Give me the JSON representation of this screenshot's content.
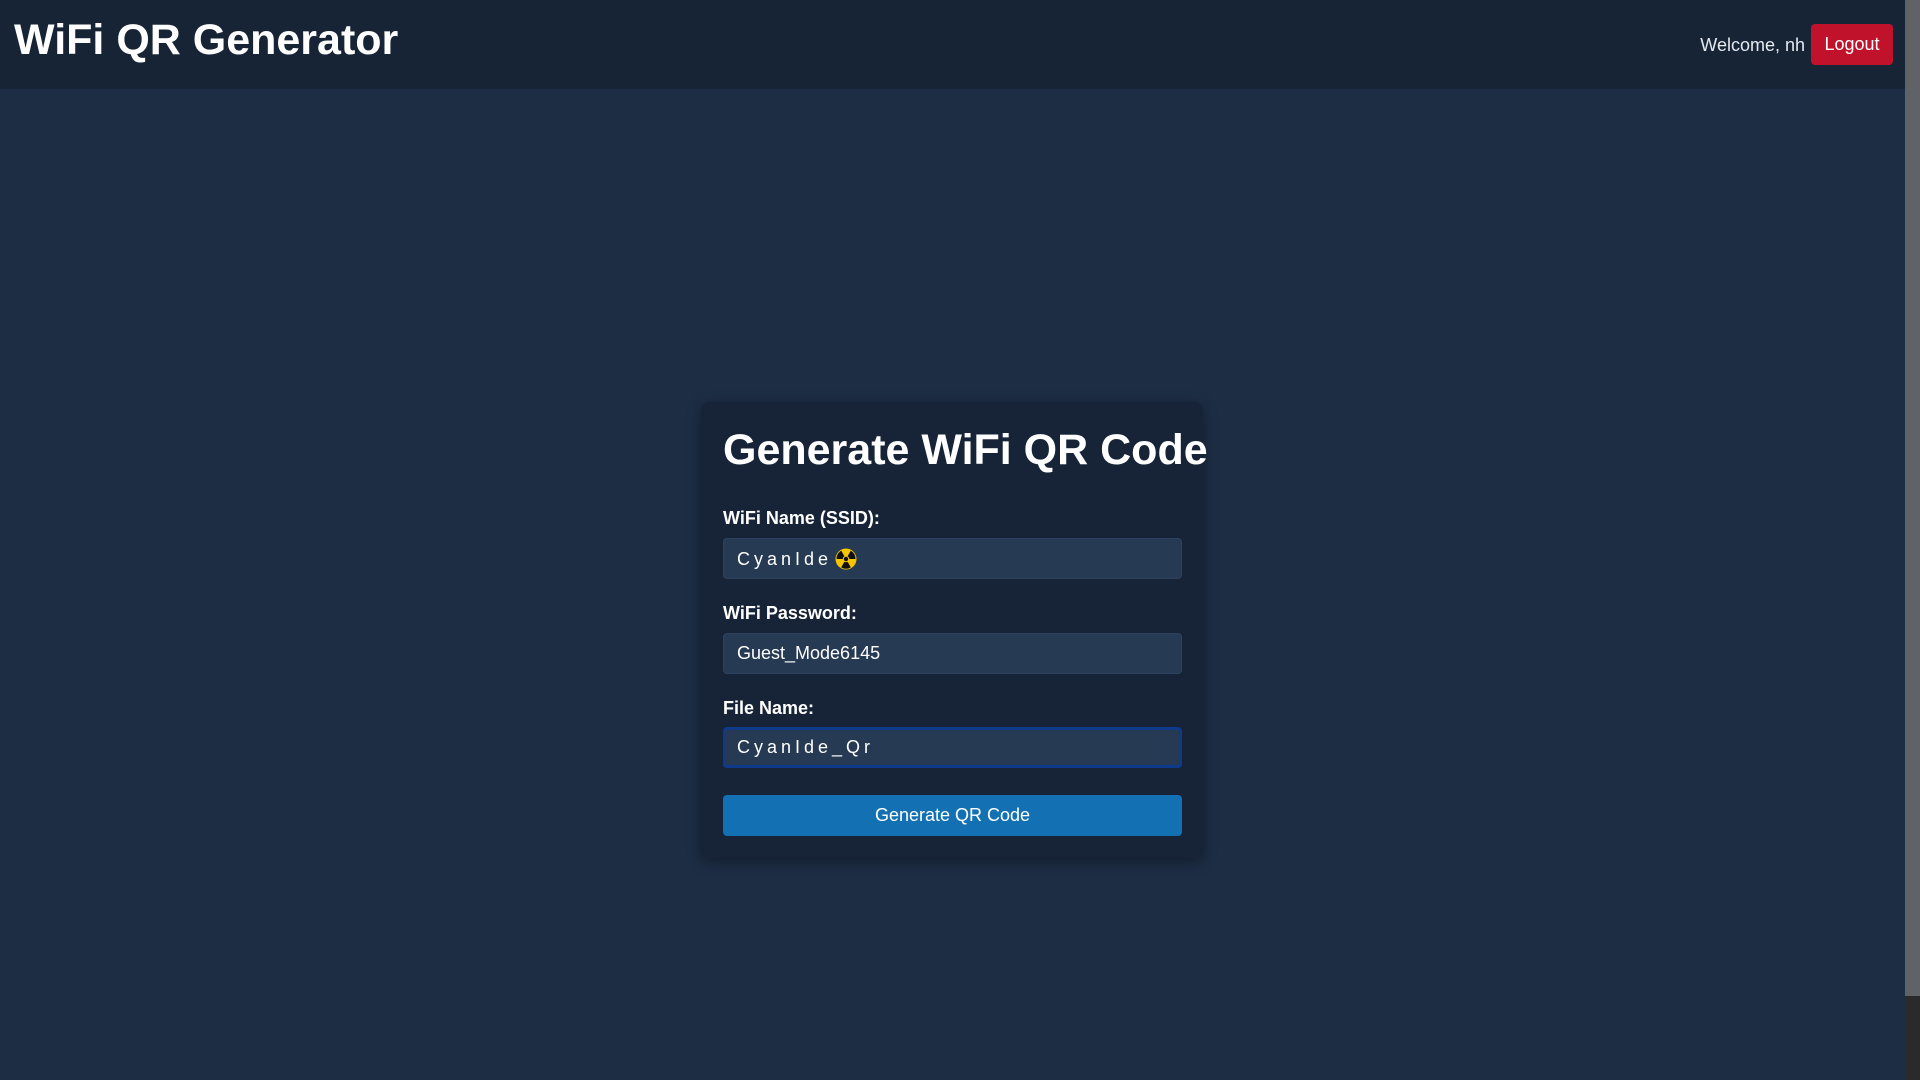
{
  "app": {
    "title": "WiFi QR Generator"
  },
  "header": {
    "welcome_text": "Welcome, nh",
    "logout_label": "Logout"
  },
  "form": {
    "title": "Generate WiFi QR Code",
    "ssid": {
      "label": "WiFi Name (SSID):",
      "value": "CyanIde",
      "trailing_icon": "radiation-icon"
    },
    "password": {
      "label": "WiFi Password:",
      "value": "Guest_Mode6145"
    },
    "filename": {
      "label": "File Name:",
      "value": "CyanIde_Qr"
    },
    "submit_label": "Generate QR Code"
  },
  "colors": {
    "background": "#1d2d44",
    "navbar": "#162436",
    "card": "#172437",
    "input": "#263a53",
    "logout": "#c0132b",
    "primary": "#1371b3",
    "focus_ring": "#0d3a8a"
  }
}
